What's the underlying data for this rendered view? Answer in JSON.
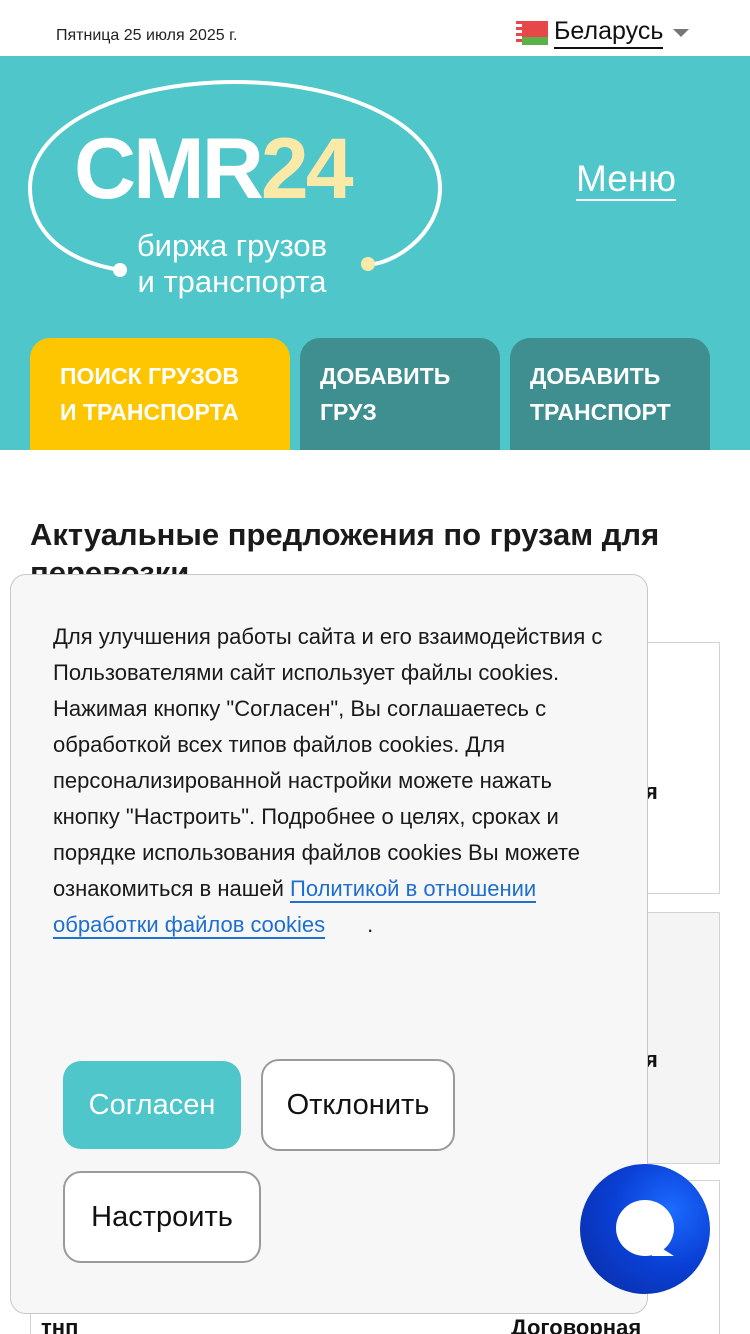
{
  "topbar": {
    "date": "Пятница 25 июля 2025 г.",
    "country": "Беларусь",
    "flag_icon": "belarus-flag-icon"
  },
  "header": {
    "logo": {
      "part1": "CMR",
      "part2": "24",
      "subtitle_line1": "биржа грузов",
      "subtitle_line2": "и транспорта"
    },
    "menu_label": "Меню",
    "tabs": [
      {
        "line1": "ПОИСК ГРУЗОВ",
        "line2": "И ТРАНСПОРТА",
        "color": "#fec600"
      },
      {
        "line1": "ДОБАВИТЬ",
        "line2": "ГРУЗ",
        "color": "#3f8e90"
      },
      {
        "line1": "ДОБАВИТЬ",
        "line2": "ТРАНСПОРТ",
        "color": "#3f8e90"
      }
    ],
    "background": "#4fc6c9"
  },
  "main": {
    "title": "Актуальные предложения по грузам для перевозки",
    "cards": [
      {
        "fragment": "я"
      },
      {
        "fragment": "я"
      },
      {
        "fragment_left": "тнп",
        "fragment_right": "Договорная"
      }
    ]
  },
  "cookie": {
    "text": "Для улучшения работы сайта и его взаимодействия с Пользователями сайт использует файлы cookies. Нажимая кнопку \"Согласен\", Вы соглашаетесь с обработкой всех типов файлов cookies. Для персонализированной настройки можете нажать кнопку \"Настроить\". Подробнее о целях, сроках и порядке использования файлов cookies Вы можете ознакомиться в нашей ",
    "link_text": "Политикой в отношении обработки файлов cookies",
    "after_link": ".",
    "accept_label": "Согласен",
    "decline_label": "Отклонить",
    "settings_label": "Настроить"
  },
  "chat": {
    "icon": "chat-bubble-icon"
  }
}
